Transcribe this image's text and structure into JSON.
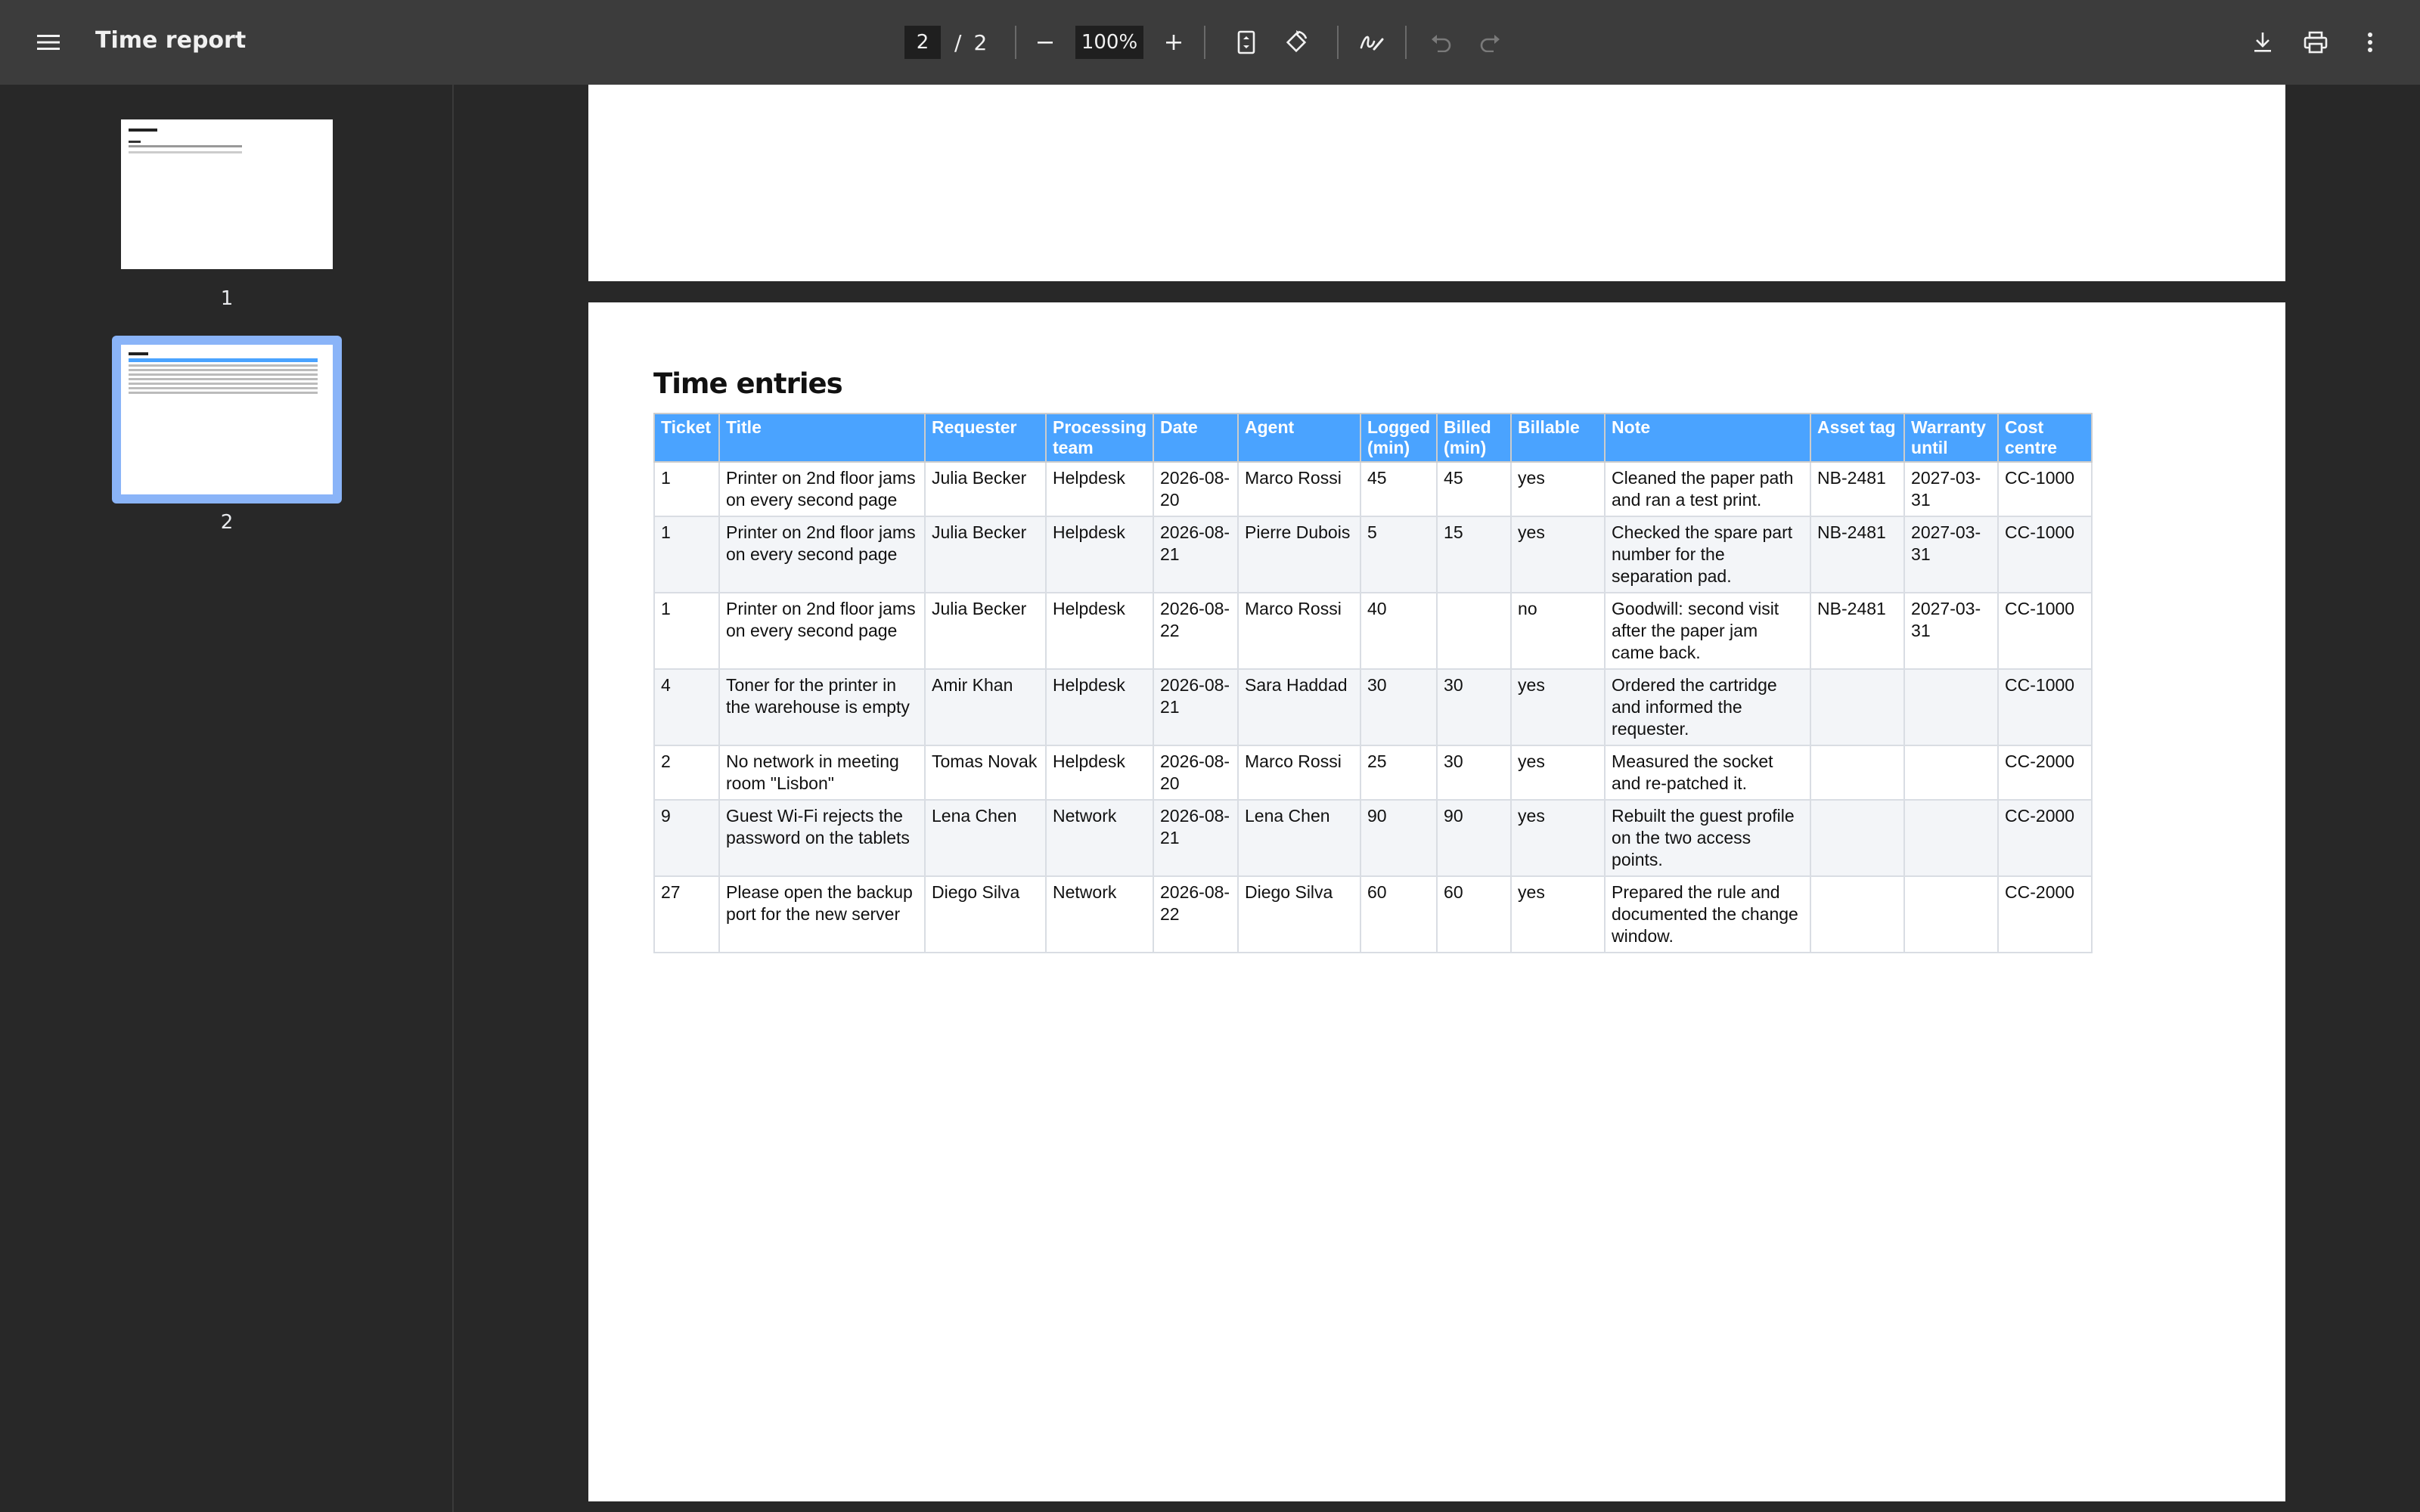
{
  "toolbar": {
    "title": "Time report",
    "current_page": "2",
    "page_separator": "/",
    "total_pages": "2",
    "zoom": "100%",
    "icons": [
      "menu-icon",
      "zoom-out-icon",
      "zoom-in-icon",
      "fit-page-icon",
      "rotate-icon",
      "annotate-icon",
      "undo-icon",
      "redo-icon",
      "download-icon",
      "print-icon",
      "more-icon"
    ]
  },
  "sidebar": {
    "thumbnails": [
      {
        "label": "1",
        "selected": false
      },
      {
        "label": "2",
        "selected": true
      }
    ]
  },
  "document": {
    "section_title": "Time entries",
    "columns": [
      "Ticket",
      "Title",
      "Requester",
      "Processing team",
      "Date",
      "Agent",
      "Logged (min)",
      "Billed (min)",
      "Billable",
      "Note",
      "Asset tag",
      "Warranty until",
      "Cost centre"
    ],
    "rows": [
      [
        "1",
        "Printer on 2nd floor jams on every second page",
        "Julia Becker",
        "Helpdesk",
        "2026-08-20",
        "Marco Rossi",
        "45",
        "45",
        "yes",
        "Cleaned the paper path and ran a test print.",
        "NB-2481",
        "2027-03-31",
        "CC-1000"
      ],
      [
        "1",
        "Printer on 2nd floor jams on every second page",
        "Julia Becker",
        "Helpdesk",
        "2026-08-21",
        "Pierre Dubois",
        "5",
        "15",
        "yes",
        "Checked the spare part number for the separation pad.",
        "NB-2481",
        "2027-03-31",
        "CC-1000"
      ],
      [
        "1",
        "Printer on 2nd floor jams on every second page",
        "Julia Becker",
        "Helpdesk",
        "2026-08-22",
        "Marco Rossi",
        "40",
        "",
        "no",
        "Goodwill: second visit after the paper jam came back.",
        "NB-2481",
        "2027-03-31",
        "CC-1000"
      ],
      [
        "4",
        "Toner for the printer in the warehouse is empty",
        "Amir Khan",
        "Helpdesk",
        "2026-08-21",
        "Sara Haddad",
        "30",
        "30",
        "yes",
        "Ordered the cartridge and informed the requester.",
        "",
        "",
        "CC-1000"
      ],
      [
        "2",
        "No network in meeting room \"Lisbon\"",
        "Tomas Novak",
        "Helpdesk",
        "2026-08-20",
        "Marco Rossi",
        "25",
        "30",
        "yes",
        "Measured the socket and re-patched it.",
        "",
        "",
        "CC-2000"
      ],
      [
        "9",
        "Guest Wi-Fi rejects the password on the tablets",
        "Lena Chen",
        "Network",
        "2026-08-21",
        "Lena Chen",
        "90",
        "90",
        "yes",
        "Rebuilt the guest profile on the two access points.",
        "",
        "",
        "CC-2000"
      ],
      [
        "27",
        "Please open the backup port for the new server",
        "Diego Silva",
        "Network",
        "2026-08-22",
        "Diego Silva",
        "60",
        "60",
        "yes",
        "Prepared the rule and documented the change window.",
        "",
        "",
        "CC-2000"
      ]
    ]
  },
  "colors": {
    "toolbar_bg": "#3c3c3c",
    "viewer_bg": "#282828",
    "table_header": "#4aa3ff",
    "thumb_selected": "#8ab4f8"
  }
}
